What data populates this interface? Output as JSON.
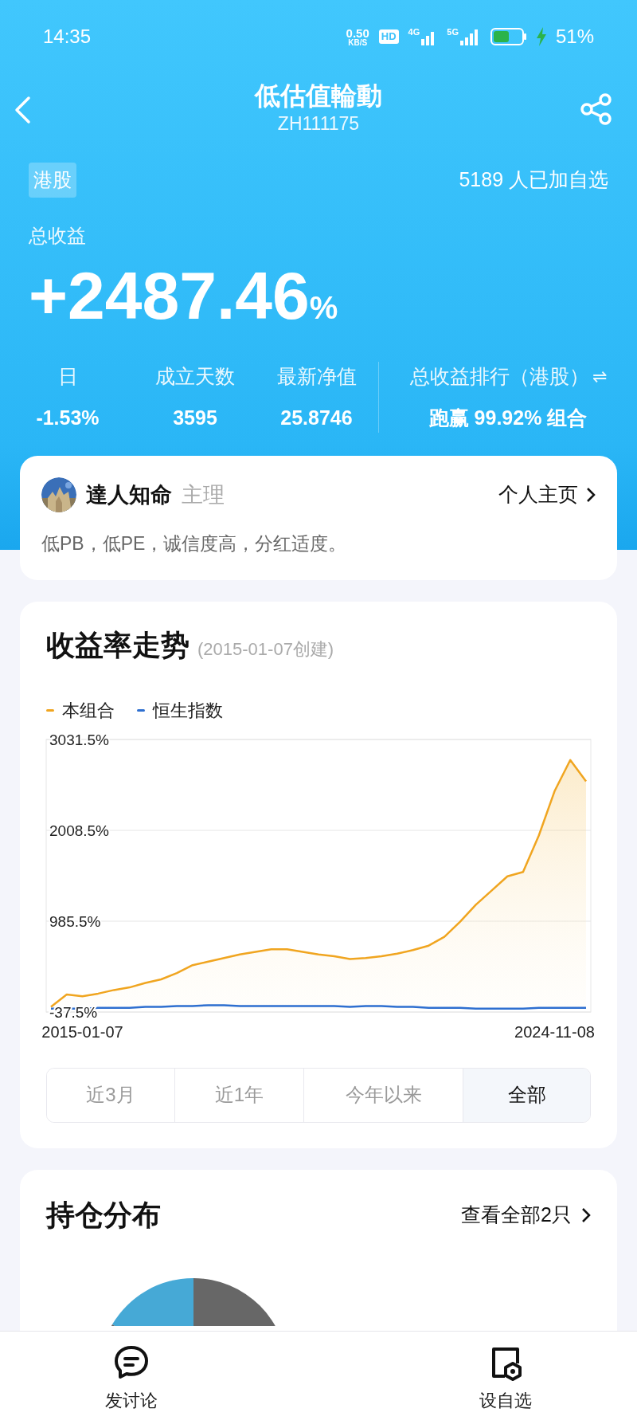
{
  "status_bar": {
    "time": "14:35",
    "net_speed": "0.50",
    "net_unit": "KB/S",
    "hd": "HD",
    "sim1": "4G",
    "sim2": "5G",
    "battery": "51%"
  },
  "header": {
    "title": "低估值輪動",
    "code": "ZH111175"
  },
  "market_tag": "港股",
  "followers": "5189 人已加自选",
  "total_return": {
    "label": "总收益",
    "number": "+2487.46",
    "unit": "%"
  },
  "stats": [
    {
      "label": "日",
      "value": "-1.53%"
    },
    {
      "label": "成立天数",
      "value": "3595"
    },
    {
      "label": "最新净值",
      "value": "25.8746"
    },
    {
      "label": "总收益排行（港股）",
      "value": "跑赢 **99.92%** 组合",
      "switch_icon": "⇌"
    }
  ],
  "manager": {
    "name": "達人知命",
    "role": "主理",
    "link": "个人主页",
    "description": "低PB，低PE，诚信度高，分红适度。"
  },
  "performance": {
    "title": "收益率走势",
    "subtitle": "(2015-01-07创建)",
    "chart_data": {
      "type": "line",
      "categories": [
        null,
        null,
        "2015-01-07",
        null,
        null,
        null,
        null,
        null,
        null,
        null,
        null,
        null,
        null,
        null,
        null,
        null,
        null,
        null,
        null,
        null,
        null,
        null,
        null,
        null,
        null,
        null,
        null,
        null,
        null,
        null,
        null,
        null,
        "2024-11-08",
        null,
        null
      ],
      "ylim": [
        -37.5,
        3031.5
      ],
      "yticks": [
        {
          "value": -37.5,
          "label": "-37.5%"
        },
        {
          "value": 985.5,
          "label": "985.5%"
        },
        {
          "value": 2008.5,
          "label": "2008.5%"
        },
        {
          "value": 3031.5,
          "label": "3031.5%"
        }
      ],
      "series": [
        {
          "name": "本组合",
          "color": "#f0a520",
          "type": "area",
          "values": [
            20,
            160,
            140,
            170,
            210,
            240,
            290,
            330,
            400,
            490,
            530,
            570,
            610,
            640,
            670,
            670,
            640,
            610,
            590,
            560,
            570,
            590,
            620,
            660,
            710,
            810,
            980,
            1170,
            1330,
            1490,
            1540,
            1950,
            2450,
            2800,
            2560
          ]
        },
        {
          "name": "恒生指数",
          "color": "#2e6fd0",
          "type": "line",
          "values": [
            0,
            0,
            0,
            10,
            10,
            10,
            20,
            20,
            30,
            30,
            40,
            40,
            30,
            30,
            30,
            30,
            30,
            30,
            30,
            20,
            30,
            30,
            20,
            20,
            10,
            10,
            10,
            0,
            0,
            0,
            0,
            10,
            10,
            10,
            10
          ]
        }
      ]
    },
    "ranges": [
      {
        "label": "近3月",
        "selected": false
      },
      {
        "label": "近1年",
        "selected": false
      },
      {
        "label": "今年以来",
        "selected": false
      },
      {
        "label": "全部",
        "selected": true
      }
    ]
  },
  "holdings": {
    "title": "持仓分布",
    "link": "查看全部2只"
  },
  "bottom_bar": [
    {
      "kind": "discuss",
      "label": "发讨论"
    },
    {
      "kind": "watch",
      "label": "设自选"
    }
  ]
}
